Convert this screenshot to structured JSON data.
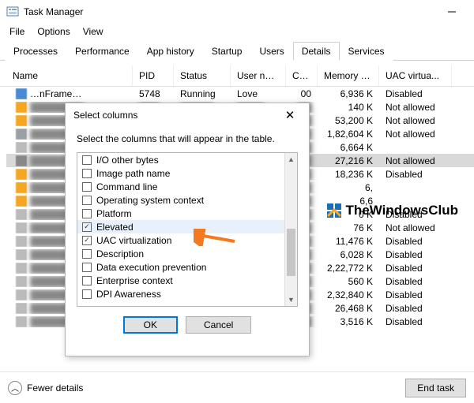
{
  "window": {
    "title": "Task Manager"
  },
  "menu": {
    "file": "File",
    "options": "Options",
    "view": "View"
  },
  "tabs": {
    "processes": "Processes",
    "performance": "Performance",
    "apphistory": "App history",
    "startup": "Startup",
    "users": "Users",
    "details": "Details",
    "services": "Services"
  },
  "columns": {
    "name": "Name",
    "pid": "PID",
    "status": "Status",
    "user": "User name",
    "cpu": "CPU",
    "memory": "Memory (a...",
    "uac": "UAC virtua..."
  },
  "rows": [
    {
      "name": "…nFrame…",
      "pid": "5748",
      "status": "Running",
      "user": "Love",
      "cpu": "00",
      "mem": "6,936 K",
      "uac": "Disabled",
      "icon": "#4b8bd6"
    },
    {
      "mem": "140 K",
      "uac": "Not allowed",
      "icon": "#f5a623"
    },
    {
      "mem": "53,200 K",
      "uac": "Not allowed",
      "icon": "#f5a623"
    },
    {
      "mem": "1,82,604 K",
      "uac": "Not allowed",
      "icon": "#9aa0a6"
    },
    {
      "mem": "6,664 K",
      "icon": "#bbbbbb"
    },
    {
      "mem": "27,216 K",
      "uac": "Not allowed",
      "selected": true,
      "icon": "#888888"
    },
    {
      "mem": "18,236 K",
      "uac": "Disabled",
      "icon": "#f5a623"
    },
    {
      "mem_part": "6,",
      "icon": "#f5a623"
    },
    {
      "mem_part": "6,6",
      "icon": "#f5a623"
    },
    {
      "mem": "0 K",
      "uac": "Disabled",
      "icon": "#bbbbbb"
    },
    {
      "mem": "76 K",
      "uac": "Not allowed",
      "icon": "#bbbbbb"
    },
    {
      "mem": "11,476 K",
      "uac": "Disabled",
      "icon": "#bbbbbb"
    },
    {
      "mem": "6,028 K",
      "uac": "Disabled",
      "icon": "#bbbbbb"
    },
    {
      "mem": "2,22,772 K",
      "uac": "Disabled",
      "icon": "#bbbbbb"
    },
    {
      "mem": "560 K",
      "uac": "Disabled",
      "icon": "#bbbbbb"
    },
    {
      "mem": "2,32,840 K",
      "uac": "Disabled",
      "icon": "#bbbbbb"
    },
    {
      "mem": "26,468 K",
      "uac": "Disabled",
      "icon": "#bbbbbb"
    },
    {
      "mem": "3,516 K",
      "uac": "Disabled",
      "icon": "#bbbbbb"
    }
  ],
  "dialog": {
    "title": "Select columns",
    "desc": "Select the columns that will appear in the table.",
    "items": [
      {
        "label": "I/O other bytes",
        "checked": false
      },
      {
        "label": "Image path name",
        "checked": false
      },
      {
        "label": "Command line",
        "checked": false
      },
      {
        "label": "Operating system context",
        "checked": false
      },
      {
        "label": "Platform",
        "checked": false
      },
      {
        "label": "Elevated",
        "checked": true,
        "hl": true
      },
      {
        "label": "UAC virtualization",
        "checked": true
      },
      {
        "label": "Description",
        "checked": false
      },
      {
        "label": "Data execution prevention",
        "checked": false
      },
      {
        "label": "Enterprise context",
        "checked": false
      },
      {
        "label": "DPI Awareness",
        "checked": false
      }
    ],
    "ok": "OK",
    "cancel": "Cancel"
  },
  "footer": {
    "fewer": "Fewer details",
    "endtask": "End task"
  },
  "watermark": "TheWindowsClub"
}
